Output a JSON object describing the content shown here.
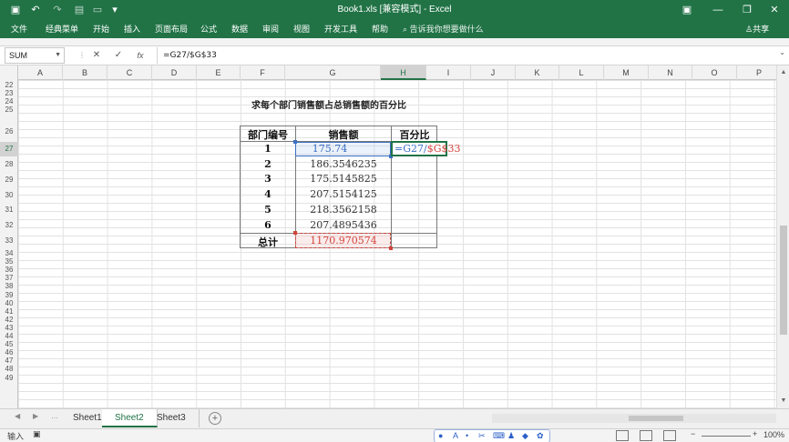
{
  "window": {
    "title": "Book1.xls  [兼容模式]  -  Excel",
    "minimize_icon": "minimize-icon",
    "restore_icon": "restore-icon",
    "close_icon": "close-icon"
  },
  "quick_access": {
    "save": "▣",
    "undo": "↶",
    "redo": "↷",
    "customize": "▾"
  },
  "ribbon": {
    "tabs": [
      "文件",
      "经典菜单",
      "开始",
      "插入",
      "页面布局",
      "公式",
      "数据",
      "审阅",
      "视图",
      "开发工具",
      "帮助"
    ],
    "tell_me": "告诉我你想要做什么",
    "share": "共享"
  },
  "formula_bar": {
    "name_box": "SUM",
    "cancel": "✕",
    "enter": "✓",
    "fx": "fx",
    "formula": "=G27/$G$33"
  },
  "columns": [
    "A",
    "B",
    "C",
    "D",
    "E",
    "F",
    "G",
    "H",
    "I",
    "J",
    "K",
    "L",
    "M",
    "N",
    "O",
    "P"
  ],
  "selected_column": "H",
  "rows": [
    "22",
    "23",
    "24",
    "25",
    "26",
    "27",
    "28",
    "29",
    "30",
    "31",
    "32",
    "33",
    "34",
    "35",
    "36",
    "37",
    "38",
    "39",
    "40",
    "41",
    "42",
    "43",
    "44",
    "45",
    "46",
    "47",
    "48",
    "49"
  ],
  "selected_row": "27",
  "sheet": {
    "title": "求每个部门销售额占总销售额的百分比",
    "headers": [
      "部门编号",
      "销售额",
      "百分比"
    ],
    "rows": [
      {
        "dept": "1",
        "sales": "175.74"
      },
      {
        "dept": "2",
        "sales": "186.3546235"
      },
      {
        "dept": "3",
        "sales": "175.5145825"
      },
      {
        "dept": "4",
        "sales": "207.5154125"
      },
      {
        "dept": "5",
        "sales": "218.3562158"
      },
      {
        "dept": "6",
        "sales": "207.4895436"
      }
    ],
    "total_label": "总计",
    "total_value": "1170.970574",
    "edit_ref_a": "=G27/",
    "edit_ref_b": "$G$33"
  },
  "tabs": {
    "sheets": [
      "Sheet1",
      "Sheet2",
      "Sheet3"
    ],
    "active": "Sheet2",
    "add": "+"
  },
  "status": {
    "mode": "输入",
    "zoom": "100%"
  },
  "colors": {
    "excel_green": "#217346",
    "ref_blue": "#3b6fc2",
    "ref_red": "#d0453c"
  }
}
